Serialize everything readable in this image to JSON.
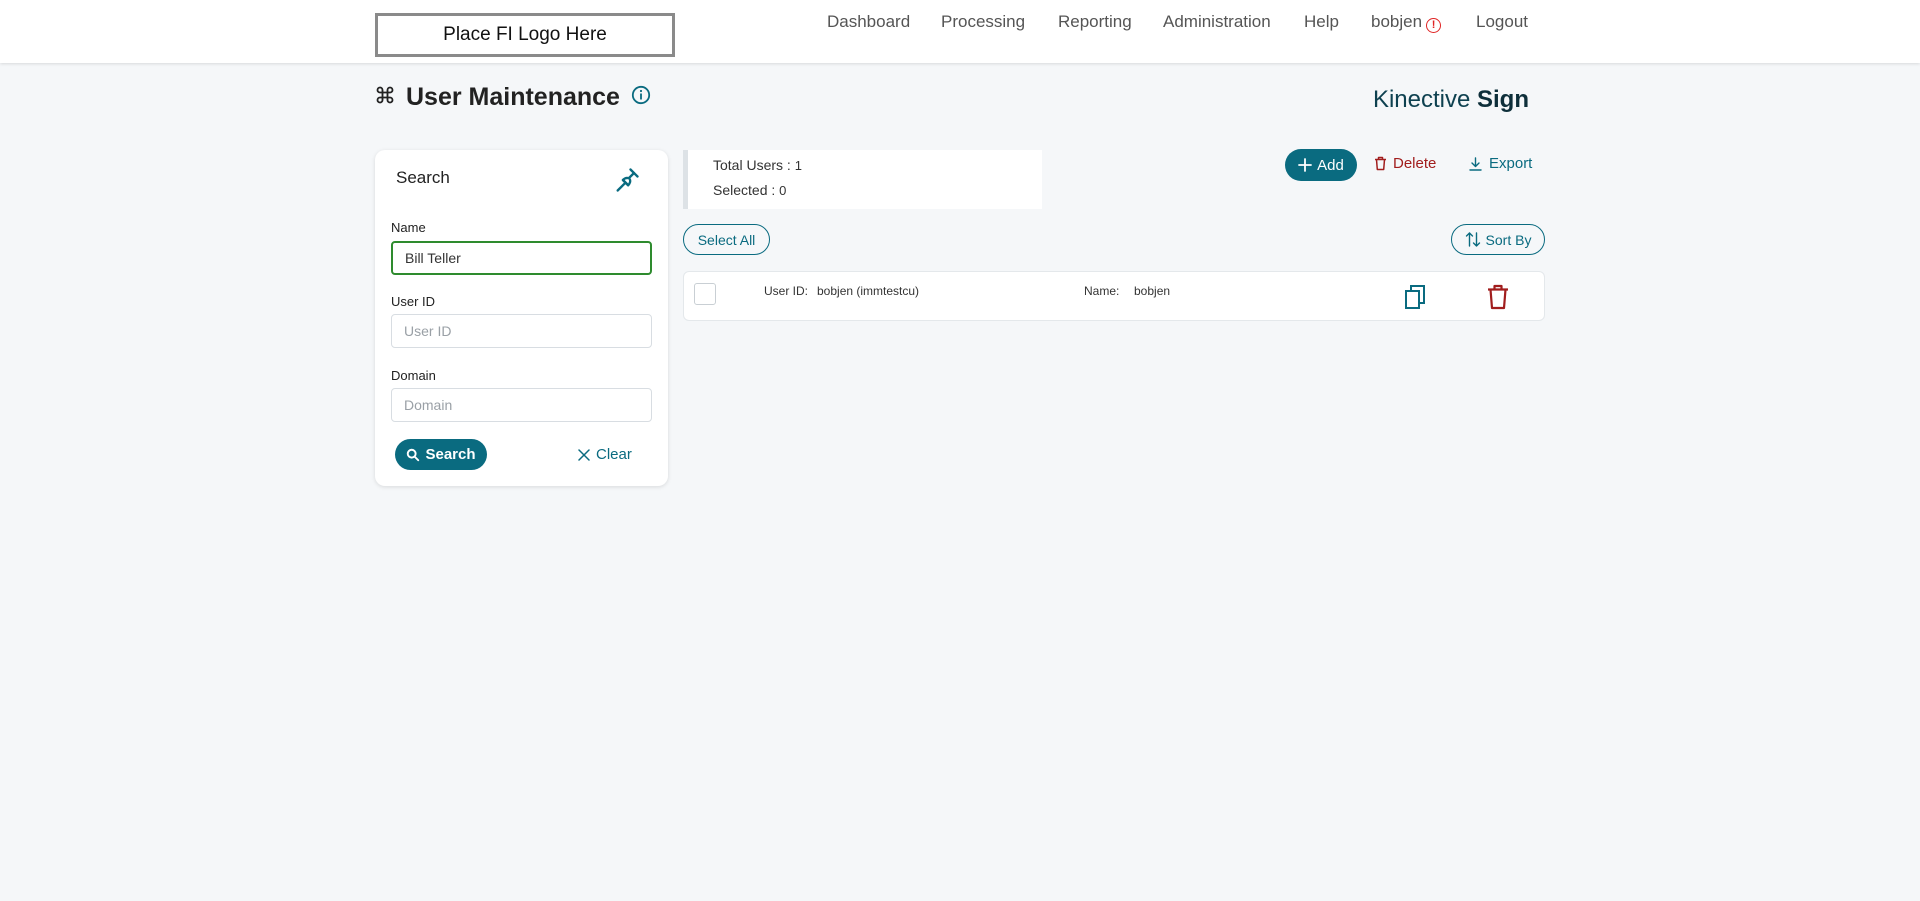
{
  "header": {
    "logo_text": "Place FI Logo Here",
    "nav": [
      "Dashboard",
      "Processing",
      "Reporting",
      "Administration",
      "Help"
    ],
    "user": "bobjen",
    "user_alert_glyph": "!",
    "logout": "Logout"
  },
  "page": {
    "title": "User Maintenance",
    "title_icon": "command-icon",
    "brand_light": "Kinective ",
    "brand_bold": "Sign"
  },
  "search": {
    "title": "Search",
    "name_label": "Name",
    "name_value": "Bill Teller",
    "userid_label": "User ID",
    "userid_placeholder": "User ID",
    "domain_label": "Domain",
    "domain_placeholder": "Domain",
    "search_button": "Search",
    "clear_button": "Clear"
  },
  "summary": {
    "total_label": "Total Users : ",
    "total_value": "1",
    "selected_label": "Selected : ",
    "selected_value": "0"
  },
  "actions": {
    "add": "Add",
    "delete": "Delete",
    "export": "Export",
    "select_all": "Select All",
    "sort_by": "Sort By"
  },
  "users": [
    {
      "userid_label": "User ID:",
      "userid_value": "bobjen (immtestcu)",
      "name_label": "Name:",
      "name_value": "bobjen"
    }
  ],
  "colors": {
    "accent": "#0a6b80",
    "danger": "#a11d1d",
    "alert": "#e02424",
    "active_border": "#2e8b2e",
    "background": "#f5f7f9"
  }
}
